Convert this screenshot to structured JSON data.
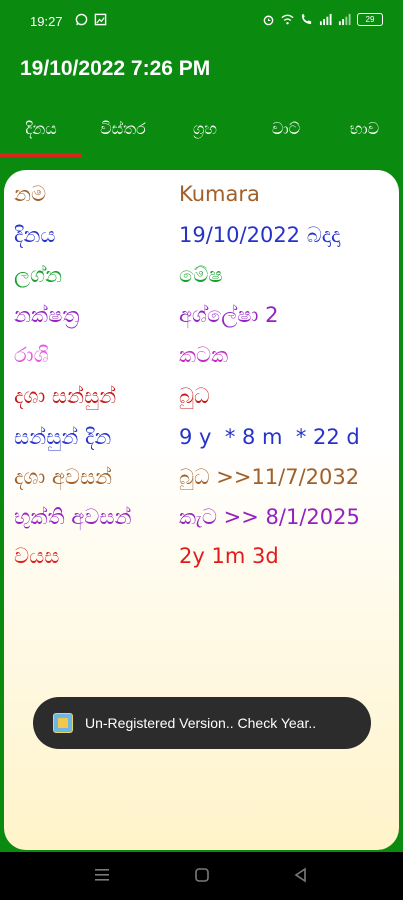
{
  "status": {
    "time": "19:27",
    "battery": "29"
  },
  "appbar": {
    "title": "19/10/2022 7:26 PM"
  },
  "tabs": [
    {
      "label": "දිනය"
    },
    {
      "label": "විස්තර"
    },
    {
      "label": "ග්‍රහ"
    },
    {
      "label": "වාට්"
    },
    {
      "label": "භාව"
    }
  ],
  "rows": [
    {
      "label": "නම",
      "value": "Kumara",
      "label_color": "#a0602b",
      "value_color": "#a0602b"
    },
    {
      "label": "දිනය",
      "value": "19/10/2022 බදාදා",
      "label_color": "#2633c9",
      "value_color": "#2633c9"
    },
    {
      "label": "ලග්න",
      "value": "මේෂ",
      "label_color": "#15a12a",
      "value_color": "#15a12a"
    },
    {
      "label": "නක්ෂත්‍ර",
      "value": "අශ්ලේෂා 2",
      "label_color": "#9422c2",
      "value_color": "#9422c2"
    },
    {
      "label": "රාශි",
      "value": "කටක",
      "label_color": "#e25ae0",
      "value_color": "#c42ac4"
    },
    {
      "label": "දශා සන්සුන්",
      "value": "බුධ",
      "label_color": "#c61a1a",
      "value_color": "#c61a1a"
    },
    {
      "label": "සන්සුන් දින",
      "value": "9 y  * 8 m  * 22 d",
      "label_color": "#2633c9",
      "value_color": "#2633c9"
    },
    {
      "label": "දශා අවසන්",
      "value": "බුධ >>11/7/2032",
      "label_color": "#a0602b",
      "value_color": "#a0602b"
    },
    {
      "label": "භුක්ති අවසන්",
      "value": "කැට >> 8/1/2025",
      "label_color": "#9422c2",
      "value_color": "#9422c2"
    },
    {
      "label": "වයස",
      "value": "2y 1m 3d",
      "label_color": "#e01b1b",
      "value_color": "#e01b1b"
    }
  ],
  "toast": {
    "text": "Un-Registered Version.. Check Year.."
  }
}
